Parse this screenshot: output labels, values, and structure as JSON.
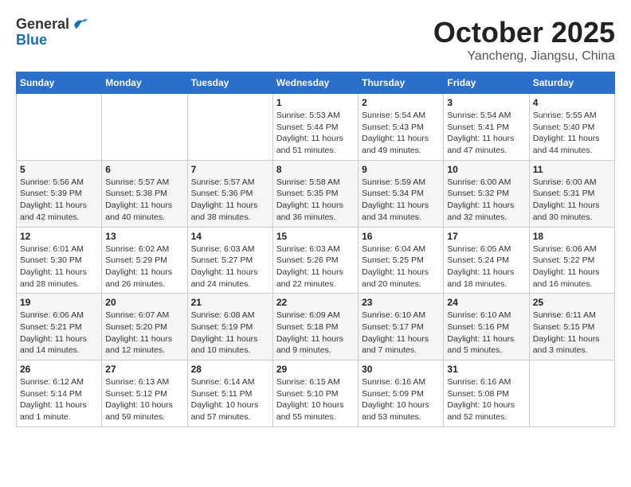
{
  "header": {
    "logo_line1": "General",
    "logo_line2": "Blue",
    "month": "October 2025",
    "location": "Yancheng, Jiangsu, China"
  },
  "weekdays": [
    "Sunday",
    "Monday",
    "Tuesday",
    "Wednesday",
    "Thursday",
    "Friday",
    "Saturday"
  ],
  "weeks": [
    [
      {
        "day": "",
        "info": ""
      },
      {
        "day": "",
        "info": ""
      },
      {
        "day": "",
        "info": ""
      },
      {
        "day": "1",
        "info": "Sunrise: 5:53 AM\nSunset: 5:44 PM\nDaylight: 11 hours and 51 minutes."
      },
      {
        "day": "2",
        "info": "Sunrise: 5:54 AM\nSunset: 5:43 PM\nDaylight: 11 hours and 49 minutes."
      },
      {
        "day": "3",
        "info": "Sunrise: 5:54 AM\nSunset: 5:41 PM\nDaylight: 11 hours and 47 minutes."
      },
      {
        "day": "4",
        "info": "Sunrise: 5:55 AM\nSunset: 5:40 PM\nDaylight: 11 hours and 44 minutes."
      }
    ],
    [
      {
        "day": "5",
        "info": "Sunrise: 5:56 AM\nSunset: 5:39 PM\nDaylight: 11 hours and 42 minutes."
      },
      {
        "day": "6",
        "info": "Sunrise: 5:57 AM\nSunset: 5:38 PM\nDaylight: 11 hours and 40 minutes."
      },
      {
        "day": "7",
        "info": "Sunrise: 5:57 AM\nSunset: 5:36 PM\nDaylight: 11 hours and 38 minutes."
      },
      {
        "day": "8",
        "info": "Sunrise: 5:58 AM\nSunset: 5:35 PM\nDaylight: 11 hours and 36 minutes."
      },
      {
        "day": "9",
        "info": "Sunrise: 5:59 AM\nSunset: 5:34 PM\nDaylight: 11 hours and 34 minutes."
      },
      {
        "day": "10",
        "info": "Sunrise: 6:00 AM\nSunset: 5:32 PM\nDaylight: 11 hours and 32 minutes."
      },
      {
        "day": "11",
        "info": "Sunrise: 6:00 AM\nSunset: 5:31 PM\nDaylight: 11 hours and 30 minutes."
      }
    ],
    [
      {
        "day": "12",
        "info": "Sunrise: 6:01 AM\nSunset: 5:30 PM\nDaylight: 11 hours and 28 minutes."
      },
      {
        "day": "13",
        "info": "Sunrise: 6:02 AM\nSunset: 5:29 PM\nDaylight: 11 hours and 26 minutes."
      },
      {
        "day": "14",
        "info": "Sunrise: 6:03 AM\nSunset: 5:27 PM\nDaylight: 11 hours and 24 minutes."
      },
      {
        "day": "15",
        "info": "Sunrise: 6:03 AM\nSunset: 5:26 PM\nDaylight: 11 hours and 22 minutes."
      },
      {
        "day": "16",
        "info": "Sunrise: 6:04 AM\nSunset: 5:25 PM\nDaylight: 11 hours and 20 minutes."
      },
      {
        "day": "17",
        "info": "Sunrise: 6:05 AM\nSunset: 5:24 PM\nDaylight: 11 hours and 18 minutes."
      },
      {
        "day": "18",
        "info": "Sunrise: 6:06 AM\nSunset: 5:22 PM\nDaylight: 11 hours and 16 minutes."
      }
    ],
    [
      {
        "day": "19",
        "info": "Sunrise: 6:06 AM\nSunset: 5:21 PM\nDaylight: 11 hours and 14 minutes."
      },
      {
        "day": "20",
        "info": "Sunrise: 6:07 AM\nSunset: 5:20 PM\nDaylight: 11 hours and 12 minutes."
      },
      {
        "day": "21",
        "info": "Sunrise: 6:08 AM\nSunset: 5:19 PM\nDaylight: 11 hours and 10 minutes."
      },
      {
        "day": "22",
        "info": "Sunrise: 6:09 AM\nSunset: 5:18 PM\nDaylight: 11 hours and 9 minutes."
      },
      {
        "day": "23",
        "info": "Sunrise: 6:10 AM\nSunset: 5:17 PM\nDaylight: 11 hours and 7 minutes."
      },
      {
        "day": "24",
        "info": "Sunrise: 6:10 AM\nSunset: 5:16 PM\nDaylight: 11 hours and 5 minutes."
      },
      {
        "day": "25",
        "info": "Sunrise: 6:11 AM\nSunset: 5:15 PM\nDaylight: 11 hours and 3 minutes."
      }
    ],
    [
      {
        "day": "26",
        "info": "Sunrise: 6:12 AM\nSunset: 5:14 PM\nDaylight: 11 hours and 1 minute."
      },
      {
        "day": "27",
        "info": "Sunrise: 6:13 AM\nSunset: 5:12 PM\nDaylight: 10 hours and 59 minutes."
      },
      {
        "day": "28",
        "info": "Sunrise: 6:14 AM\nSunset: 5:11 PM\nDaylight: 10 hours and 57 minutes."
      },
      {
        "day": "29",
        "info": "Sunrise: 6:15 AM\nSunset: 5:10 PM\nDaylight: 10 hours and 55 minutes."
      },
      {
        "day": "30",
        "info": "Sunrise: 6:16 AM\nSunset: 5:09 PM\nDaylight: 10 hours and 53 minutes."
      },
      {
        "day": "31",
        "info": "Sunrise: 6:16 AM\nSunset: 5:08 PM\nDaylight: 10 hours and 52 minutes."
      },
      {
        "day": "",
        "info": ""
      }
    ]
  ]
}
